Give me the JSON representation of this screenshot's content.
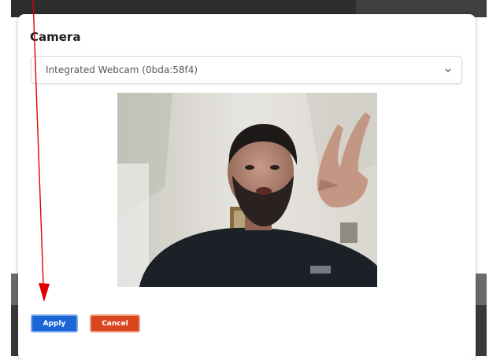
{
  "dialog": {
    "title": "Camera",
    "camera_select": {
      "selected_value": "Integrated Webcam (0bda:58f4)"
    },
    "preview": {
      "kind": "live webcam video feed"
    },
    "actions": {
      "apply_label": "Apply",
      "cancel_label": "Cancel"
    }
  },
  "colors": {
    "apply": "#1a66d6",
    "cancel": "#d8461e",
    "annotation_arrow": "#e00000"
  },
  "icons": {
    "select_indicator": "chevron-down-icon"
  }
}
